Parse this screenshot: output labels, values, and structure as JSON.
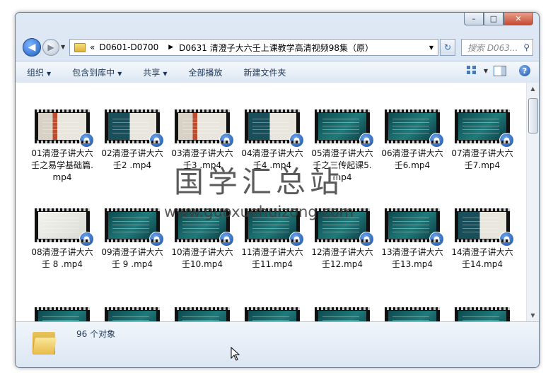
{
  "window": {
    "caption_buttons": [
      "minimize",
      "maximize",
      "close"
    ]
  },
  "navigation": {
    "path": [
      "D0601-D0700",
      "D0631 清澄子大六壬上课教学高清视频98集（原）"
    ],
    "path_prefix": "«",
    "search_placeholder": "搜索 D063..."
  },
  "toolbar": {
    "items": [
      "组织",
      "包含到库中",
      "共享",
      "全部播放",
      "新建文件夹"
    ]
  },
  "files": [
    {
      "name": "01清澄子讲大六壬之易学基础篇.mp4",
      "style": "portrait"
    },
    {
      "name": "02清澄子讲大六壬2 .mp4",
      "style": "mixed"
    },
    {
      "name": "03清澄子讲大六壬3 .mp4",
      "style": "portrait"
    },
    {
      "name": "04清澄子讲大六壬4 .mp4",
      "style": "mixed"
    },
    {
      "name": "05清澄子讲大六壬之三传起课5.mp4",
      "style": "dark"
    },
    {
      "name": "06清澄子讲大六壬6.mp4",
      "style": "dark"
    },
    {
      "name": "07清澄子讲大六壬7.mp4",
      "style": "dark"
    },
    {
      "name": "08清澄子讲大六壬 8 .mp4",
      "style": "light"
    },
    {
      "name": "09清澄子讲大六壬 9 .mp4",
      "style": "dark"
    },
    {
      "name": "10清澄子讲大六壬10.mp4",
      "style": "dark"
    },
    {
      "name": "11清澄子讲大六壬11.mp4",
      "style": "dark"
    },
    {
      "name": "12清澄子讲大六壬12.mp4",
      "style": "dark"
    },
    {
      "name": "13清澄子讲大六壬13.mp4",
      "style": "dark"
    },
    {
      "name": "14清澄子讲大六壬14.mp4",
      "style": "mixed"
    },
    {
      "name": "",
      "style": "dark"
    },
    {
      "name": "",
      "style": "dark"
    },
    {
      "name": "",
      "style": "dark"
    },
    {
      "name": "",
      "style": "dark"
    },
    {
      "name": "",
      "style": "dark"
    },
    {
      "name": "",
      "style": "dark"
    },
    {
      "name": "",
      "style": "dark"
    }
  ],
  "watermark": {
    "text_cn": "国学汇总站",
    "url": "www.guoxuehuizong.com"
  },
  "details": {
    "count_text": "96 个对象"
  }
}
